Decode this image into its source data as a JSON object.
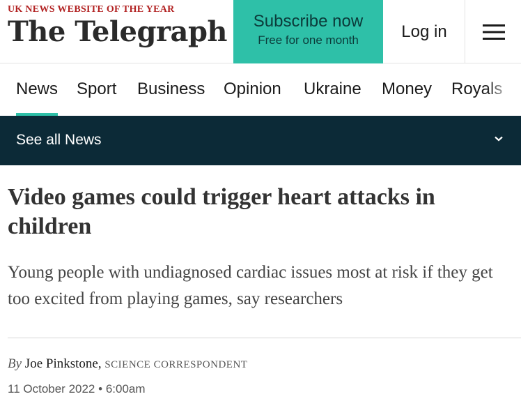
{
  "header": {
    "award": "UK NEWS WEBSITE OF THE YEAR",
    "logo": "The Telegraph",
    "subscribe_main": "Subscribe now",
    "subscribe_sub": "Free for one month",
    "login": "Log in",
    "menu_icon": "hamburger-menu-icon"
  },
  "nav": {
    "items": [
      {
        "label": "News",
        "active": true
      },
      {
        "label": "Sport",
        "active": false
      },
      {
        "label": "Business",
        "active": false
      },
      {
        "label": "Opinion",
        "active": false
      },
      {
        "label": "Ukraine",
        "active": false
      },
      {
        "label": "Money",
        "active": false
      },
      {
        "label": "Royals",
        "active": false
      }
    ],
    "see_all": "See all News",
    "see_all_icon": "chevron-down-icon"
  },
  "article": {
    "headline": "Video games could trigger heart attacks in children",
    "standfirst": "Young people with undiagnosed cardiac issues most at risk if they get too excited from playing games, say researchers",
    "byline_prefix": "By",
    "author": "Joe Pinkstone,",
    "role": "SCIENCE CORRESPONDENT",
    "date": "11 October 2022",
    "separator": "•",
    "time": "6:00am"
  },
  "colors": {
    "accent": "#2ec0a8",
    "nav_bar": "#0c2a37",
    "award_red": "#b22222"
  }
}
